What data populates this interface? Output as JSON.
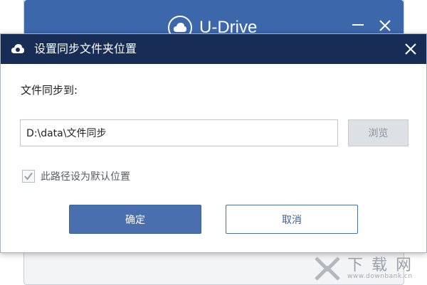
{
  "main_window": {
    "brand": "U-Drive",
    "minimize_icon": "minimize-icon",
    "close_icon": "close-icon",
    "header_color": "#3d67ab"
  },
  "dialog": {
    "title": "设置同步文件夹位置",
    "title_bar_color": "#172d55",
    "close_icon": "close-icon",
    "sync_label": "文件同步到:",
    "path_value": "D:\\data\\文件同步",
    "browse_label": "浏览",
    "default_checkbox": {
      "label": "此路径设为默认位置",
      "checked": true
    },
    "confirm_label": "确定",
    "cancel_label": "取消",
    "accent_color": "#4a6fae"
  },
  "watermark": {
    "name": "下载网",
    "url": "www.downbank.cn"
  }
}
